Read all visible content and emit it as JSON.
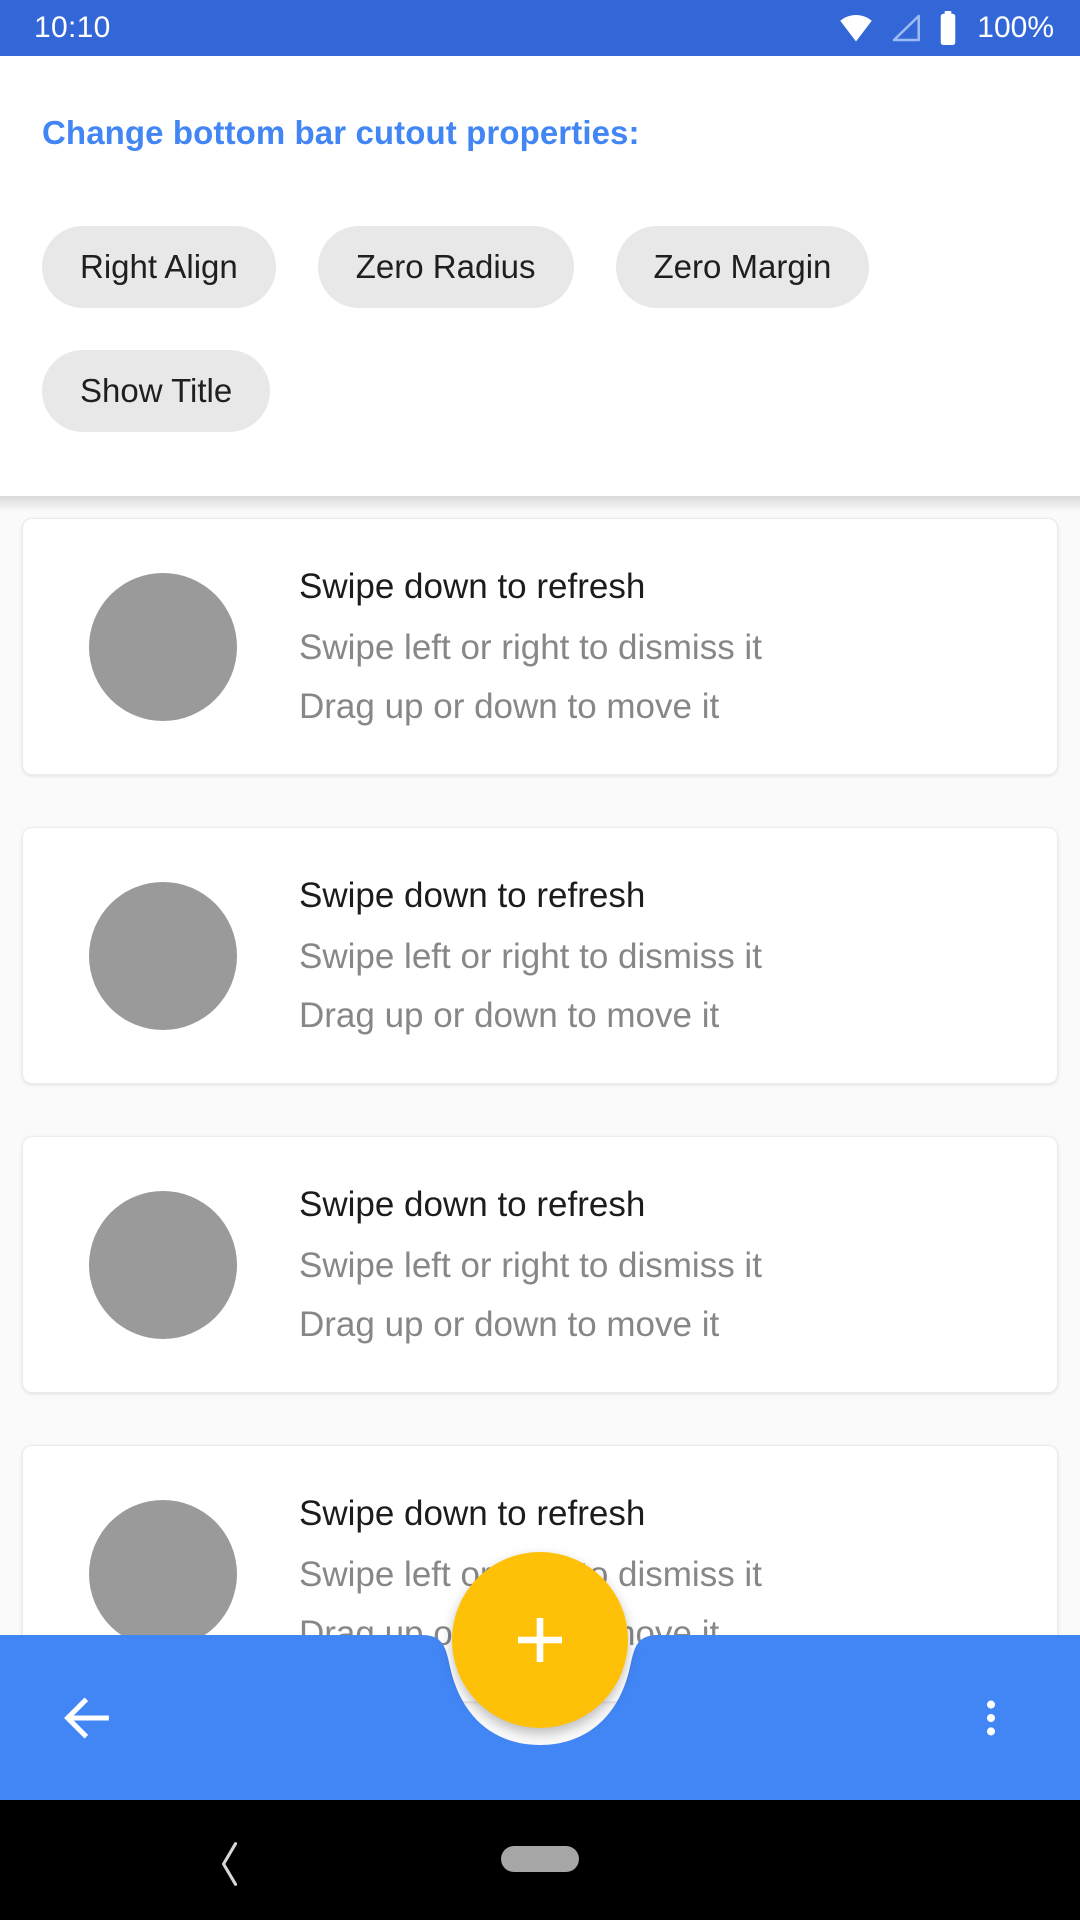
{
  "status_bar": {
    "clock": "10:10",
    "battery_percent": "100%",
    "icons": [
      "wifi-icon",
      "signal-icon",
      "battery-icon"
    ],
    "background_color": "#3366D6"
  },
  "header": {
    "title": "Change bottom bar cutout properties:",
    "title_color": "#4285F4",
    "chips": [
      {
        "label": "Right Align"
      },
      {
        "label": "Zero Radius"
      },
      {
        "label": "Zero Margin"
      },
      {
        "label": "Show Title"
      }
    ],
    "chip_background": "#E8E8E8"
  },
  "list": {
    "items": [
      {
        "title": "Swipe down to refresh",
        "sub1": "Swipe left or right to dismiss it",
        "sub2": "Drag up or down to move it"
      },
      {
        "title": "Swipe down to refresh",
        "sub1": "Swipe left or right to dismiss it",
        "sub2": "Drag up or down to move it"
      },
      {
        "title": "Swipe down to refresh",
        "sub1": "Swipe left or right to dismiss it",
        "sub2": "Drag up or down to move it"
      },
      {
        "title": "Swipe down to refresh",
        "sub1": "Swipe left or right to dismiss it",
        "sub2": "Drag up or down to move it"
      }
    ],
    "avatar_color": "#9A9A9A",
    "background_color": "#FAFAFA"
  },
  "bottom_bar": {
    "background_color": "#4285F4",
    "navigation_icon": "back-arrow-icon",
    "overflow_icon": "more-vert-icon",
    "title": "",
    "cutout": "center"
  },
  "fab": {
    "icon": "plus-icon",
    "color": "#FFC107",
    "icon_color": "#FFFFFF"
  },
  "nav_bar": {
    "background_color": "#000000",
    "back_icon": "chevron-left-icon",
    "home_indicator": "home-pill"
  }
}
